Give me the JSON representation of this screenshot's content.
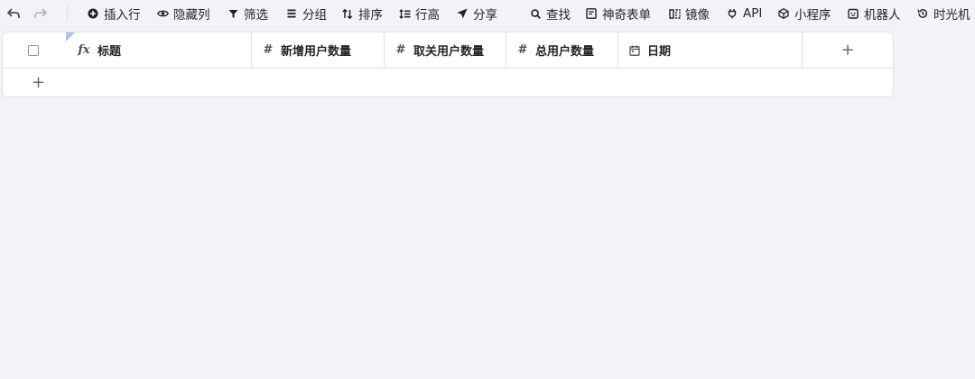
{
  "toolbar": {
    "undo_icon": "undo-arrow-icon",
    "redo_icon": "redo-arrow-icon",
    "items": [
      {
        "label": "插入行",
        "icon": "plus-circle-icon"
      },
      {
        "label": "隐藏列",
        "icon": "eye-icon"
      },
      {
        "label": "筛选",
        "icon": "filter-icon"
      },
      {
        "label": "分组",
        "icon": "group-lines-icon"
      },
      {
        "label": "排序",
        "icon": "sort-icon"
      },
      {
        "label": "行高",
        "icon": "row-height-icon"
      },
      {
        "label": "分享",
        "icon": "send-icon"
      },
      {
        "label": "查找",
        "icon": "search-icon"
      },
      {
        "label": "神奇表单",
        "icon": "form-icon"
      },
      {
        "label": "镜像",
        "icon": "mirror-icon"
      },
      {
        "label": "API",
        "icon": "plug-icon"
      },
      {
        "label": "小程序",
        "icon": "cube-icon"
      },
      {
        "label": "机器人",
        "icon": "robot-icon"
      },
      {
        "label": "时光机",
        "icon": "history-icon"
      }
    ]
  },
  "table": {
    "columns": [
      {
        "label": "标题",
        "icon": "formula-icon",
        "icon_text": "fx"
      },
      {
        "label": "新增用户数量",
        "icon": "hash-icon",
        "icon_text": "#"
      },
      {
        "label": "取关用户数量",
        "icon": "hash-icon",
        "icon_text": "#"
      },
      {
        "label": "总用户数量",
        "icon": "hash-icon",
        "icon_text": "#"
      },
      {
        "label": "日期",
        "icon": "calendar-icon"
      }
    ],
    "add_column_label": "+",
    "add_row_label": "+"
  },
  "colors": {
    "background": "#f1f3f7",
    "border": "#dee0e3",
    "text": "#1f2329",
    "corner_marker": "#a9c1f5"
  }
}
